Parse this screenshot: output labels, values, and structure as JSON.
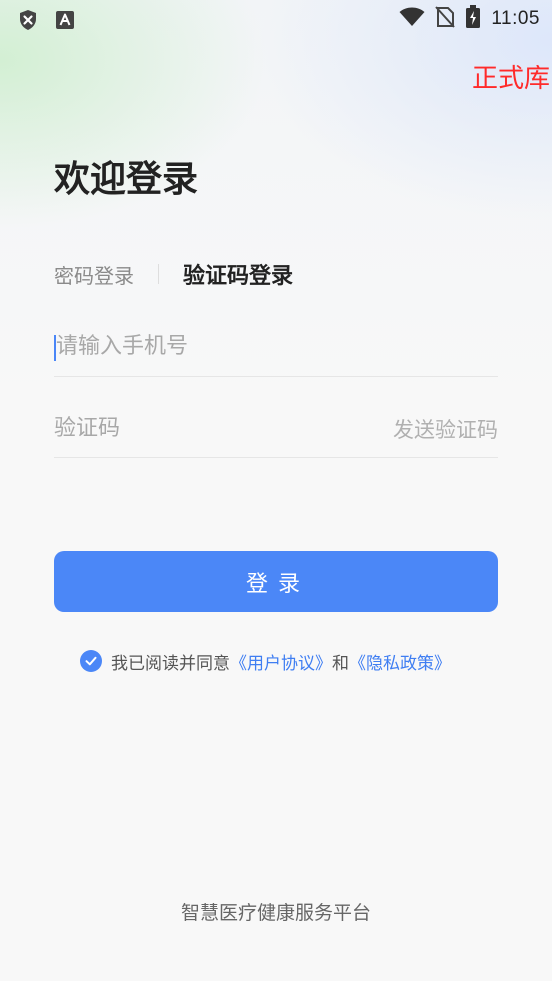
{
  "status_bar": {
    "time": "11:05",
    "left_icons": [
      "shield-close-icon",
      "font-a-icon"
    ],
    "right_icons": [
      "wifi-icon",
      "no-sim-icon",
      "battery-charging-icon"
    ]
  },
  "env_label": "正式库",
  "welcome_title": "欢迎登录",
  "tabs": {
    "password_login": "密码登录",
    "code_login": "验证码登录",
    "active": "验证码登录"
  },
  "phone_field": {
    "placeholder": "请输入手机号",
    "value": ""
  },
  "code_field": {
    "placeholder": "验证码",
    "value": ""
  },
  "send_code_label": "发送验证码",
  "login_button_label": "登录",
  "agreement": {
    "checked": true,
    "prefix": "我已阅读并同意",
    "user_agreement": "《用户协议》",
    "conjunction": "和",
    "privacy_policy": "《隐私政策》"
  },
  "footer": "智慧医疗健康服务平台",
  "colors": {
    "primary": "#4b87f7",
    "env_label": "#ff2a2a",
    "link": "#3f7ef2"
  }
}
